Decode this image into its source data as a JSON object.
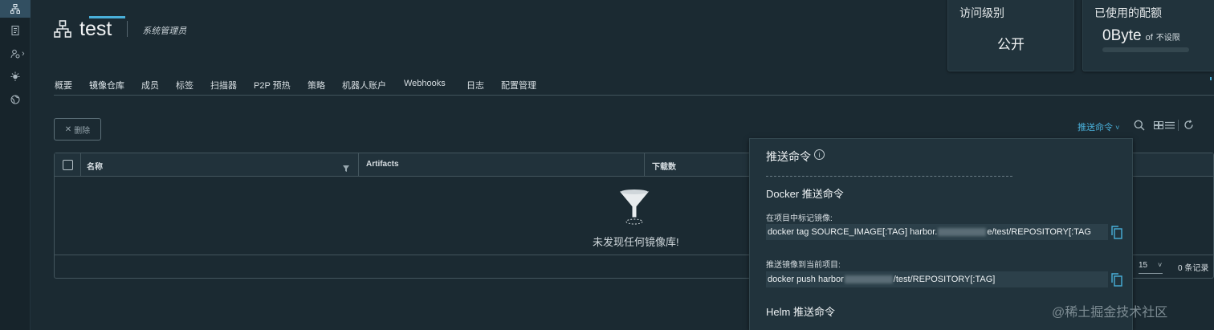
{
  "sidebar": {
    "items": [
      {
        "icon": "project-icon",
        "active": true
      },
      {
        "icon": "log-icon",
        "active": false
      },
      {
        "icon": "user-admin-icon",
        "active": false
      },
      {
        "icon": "interrogation-icon",
        "active": false
      },
      {
        "icon": "distribution-icon",
        "active": false
      }
    ]
  },
  "project": {
    "icon": "project-icon",
    "name": "test",
    "role": "系统管理员"
  },
  "cards": {
    "access": {
      "label": "访问级别",
      "value": "公开"
    },
    "quota": {
      "label": "已使用的配额",
      "used": "0Byte",
      "of": "of",
      "limit": "不设限"
    }
  },
  "tabs": [
    {
      "label": "概要",
      "active": false
    },
    {
      "label": "镜像仓库",
      "active": true
    },
    {
      "label": "成员",
      "active": false
    },
    {
      "label": "标签",
      "active": false
    },
    {
      "label": "扫描器",
      "active": false
    },
    {
      "label": "P2P 预热",
      "active": false
    },
    {
      "label": "策略",
      "active": false
    },
    {
      "label": "机器人账户",
      "active": false
    },
    {
      "label": "Webhooks",
      "active": false
    },
    {
      "label": "日志",
      "active": false
    },
    {
      "label": "配置管理",
      "active": false
    }
  ],
  "toolbar": {
    "delete_label": "删除",
    "push_command_label": "推送命令",
    "icons": [
      "search-icon",
      "card-view-icon",
      "list-view-icon",
      "refresh-icon"
    ]
  },
  "grid": {
    "columns": [
      "名称",
      "Artifacts",
      "下载数"
    ],
    "empty_text": "未发现任何镜像库!",
    "page_size": "15",
    "record_count": "0 条记录"
  },
  "popover": {
    "title": "推送命令",
    "docker_title": "Docker 推送命令",
    "tag_label": "在项目中标记镜像:",
    "tag_command_prefix": "docker tag SOURCE_IMAGE[:TAG] harbor.",
    "tag_command_suffix": "e/test/REPOSITORY[:TAG",
    "push_label": "推送镜像到当前项目:",
    "push_command_prefix": "docker push harbor",
    "push_command_suffix": "/test/REPOSITORY[:TAG]",
    "helm_title": "Helm 推送命令"
  },
  "colors": {
    "background": "#1b2a32",
    "accent": "#49afd9",
    "card": "#21333c"
  },
  "watermark": "@稀土掘金技术社区"
}
